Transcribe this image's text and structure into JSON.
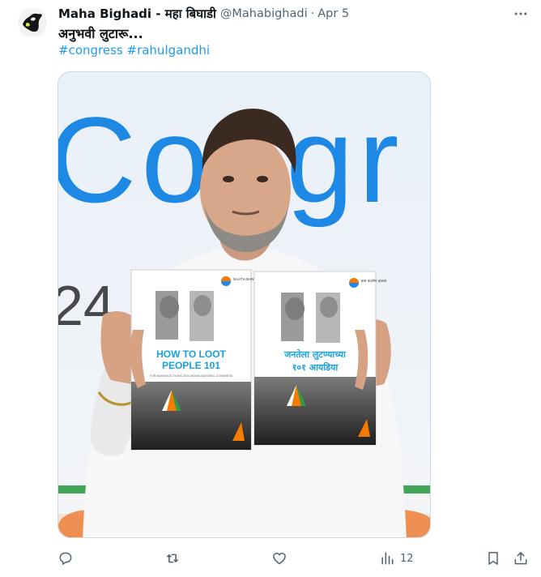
{
  "tweet": {
    "display_name": "Maha Bighadi - महा बिघाडी",
    "handle": "@Mahabighadi",
    "separator": "·",
    "date": "Apr 5",
    "text": "अनुभवी लुटारू...",
    "hashtags": [
      "#congress",
      "#rahulgandhi"
    ]
  },
  "media": {
    "backdrop_text": "Congr",
    "backdrop_number": "24",
    "left_booklet": {
      "brand": "NAATH BANAAYA HALAAT",
      "title_line1": "HOW TO LOOT",
      "title_line2": "PEOPLE 101",
      "subtitle": "FOR MAHA ELECTIONS 2024 INDIAN NATIONAL CONGRESS"
    },
    "right_booklet": {
      "brand": "हाथ बदलेगा हालात",
      "title_line1": "जनतेला लुटण्याच्या",
      "title_line2": "१०१ आयडिया"
    }
  },
  "actions": {
    "views_count": "12"
  },
  "colors": {
    "text": "#0f1419",
    "secondary": "#536471",
    "link": "#1d9bf0",
    "border": "#cfd9de"
  },
  "icons": [
    "more-icon",
    "reply-icon",
    "retweet-icon",
    "like-icon",
    "views-icon",
    "bookmark-icon",
    "share-icon"
  ]
}
